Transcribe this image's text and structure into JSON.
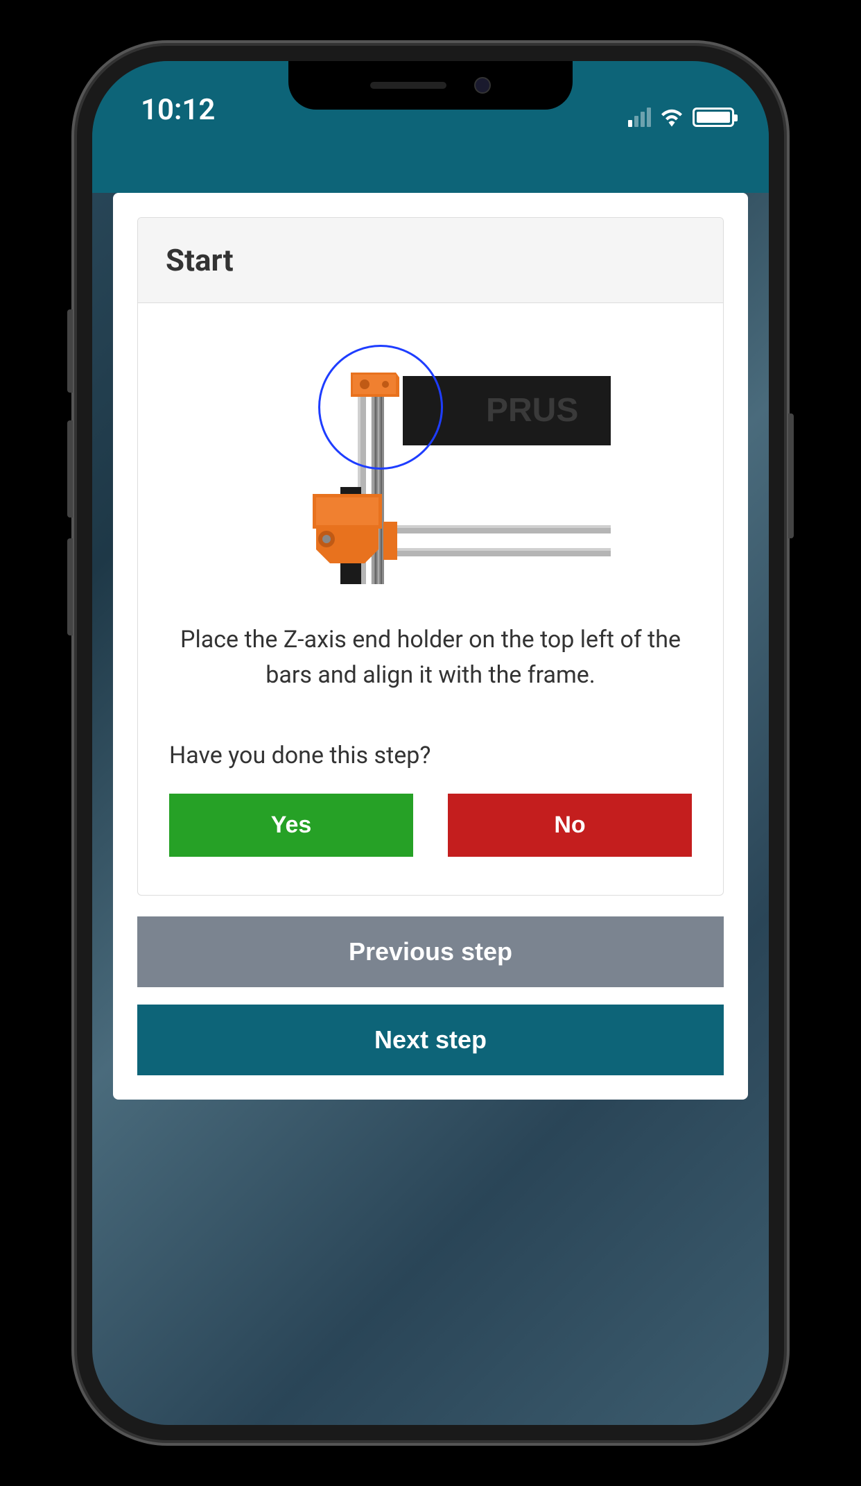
{
  "status_bar": {
    "time": "10:12"
  },
  "card": {
    "title": "Start",
    "instruction": "Place the Z-axis end holder on the top left of the bars and align it with the frame.",
    "question": "Have you done this step?",
    "yes_label": "Yes",
    "no_label": "No",
    "image_label_text": "PRUS"
  },
  "navigation": {
    "previous_label": "Previous step",
    "next_label": "Next step"
  },
  "colors": {
    "header": "#0d6478",
    "yes_button": "#26a126",
    "no_button": "#c41e1e",
    "prev_button": "#7b8490",
    "next_button": "#0d6478",
    "highlight_circle": "#1e3dff"
  }
}
